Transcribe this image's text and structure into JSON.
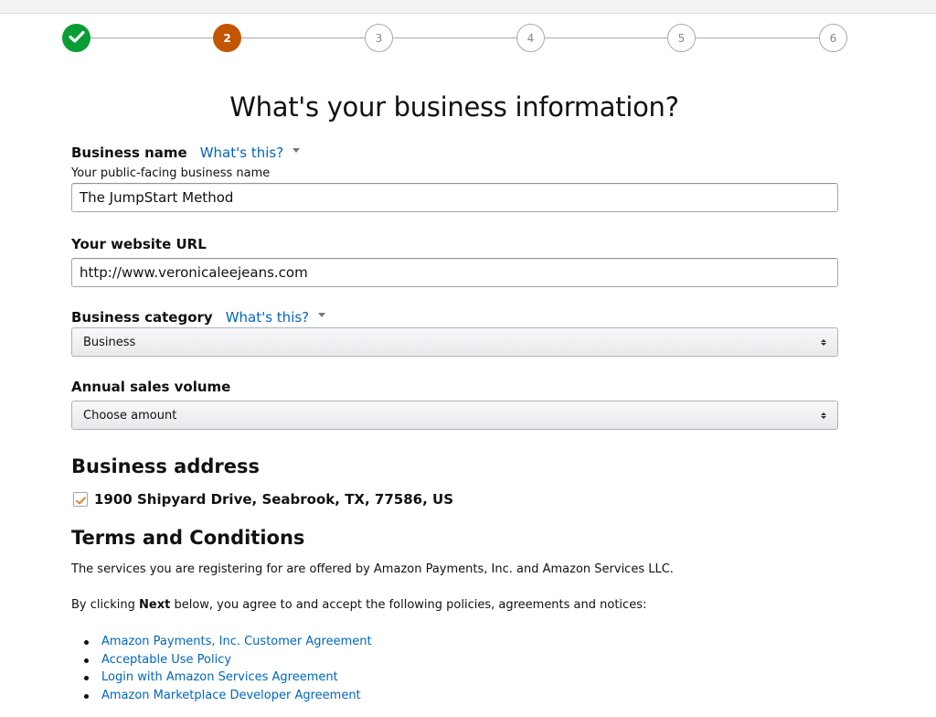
{
  "stepper": {
    "steps": [
      {
        "label": "",
        "state": "done",
        "icon": "check-icon"
      },
      {
        "label": "2",
        "state": "active"
      },
      {
        "label": "3",
        "state": "todo"
      },
      {
        "label": "4",
        "state": "todo"
      },
      {
        "label": "5",
        "state": "todo"
      },
      {
        "label": "6",
        "state": "todo"
      }
    ],
    "colors": {
      "done": "#0a9c35",
      "active": "#c45500",
      "todo_border": "#a9a9a9"
    }
  },
  "page_title": "What's your business information?",
  "business_name": {
    "label": "Business name",
    "help_link": "What's this?",
    "sublabel": "Your public-facing business name",
    "value": "The JumpStart Method"
  },
  "website": {
    "label": "Your website URL",
    "value": "http://www.veronicaleejeans.com"
  },
  "business_category": {
    "label": "Business category",
    "help_link": "What's this?",
    "selected": "Business"
  },
  "annual_sales": {
    "label": "Annual sales volume",
    "selected": "Choose amount"
  },
  "business_address": {
    "heading": "Business address",
    "address": "1900 Shipyard Drive, Seabrook, TX, 77586, US",
    "checked": true
  },
  "terms": {
    "heading": "Terms and Conditions",
    "para1": "The services you are registering for are offered by Amazon Payments, Inc. and Amazon Services LLC.",
    "para2_prefix": "By clicking ",
    "para2_bold": "Next",
    "para2_suffix": " below, you agree to and accept the following policies, agreements and notices:",
    "links": [
      "Amazon Payments, Inc. Customer Agreement",
      "Acceptable Use Policy",
      "Login with Amazon Services Agreement",
      "Amazon Marketplace Developer Agreement"
    ]
  },
  "colors": {
    "link": "#0066c0",
    "checkbox_check": "#e47911"
  }
}
